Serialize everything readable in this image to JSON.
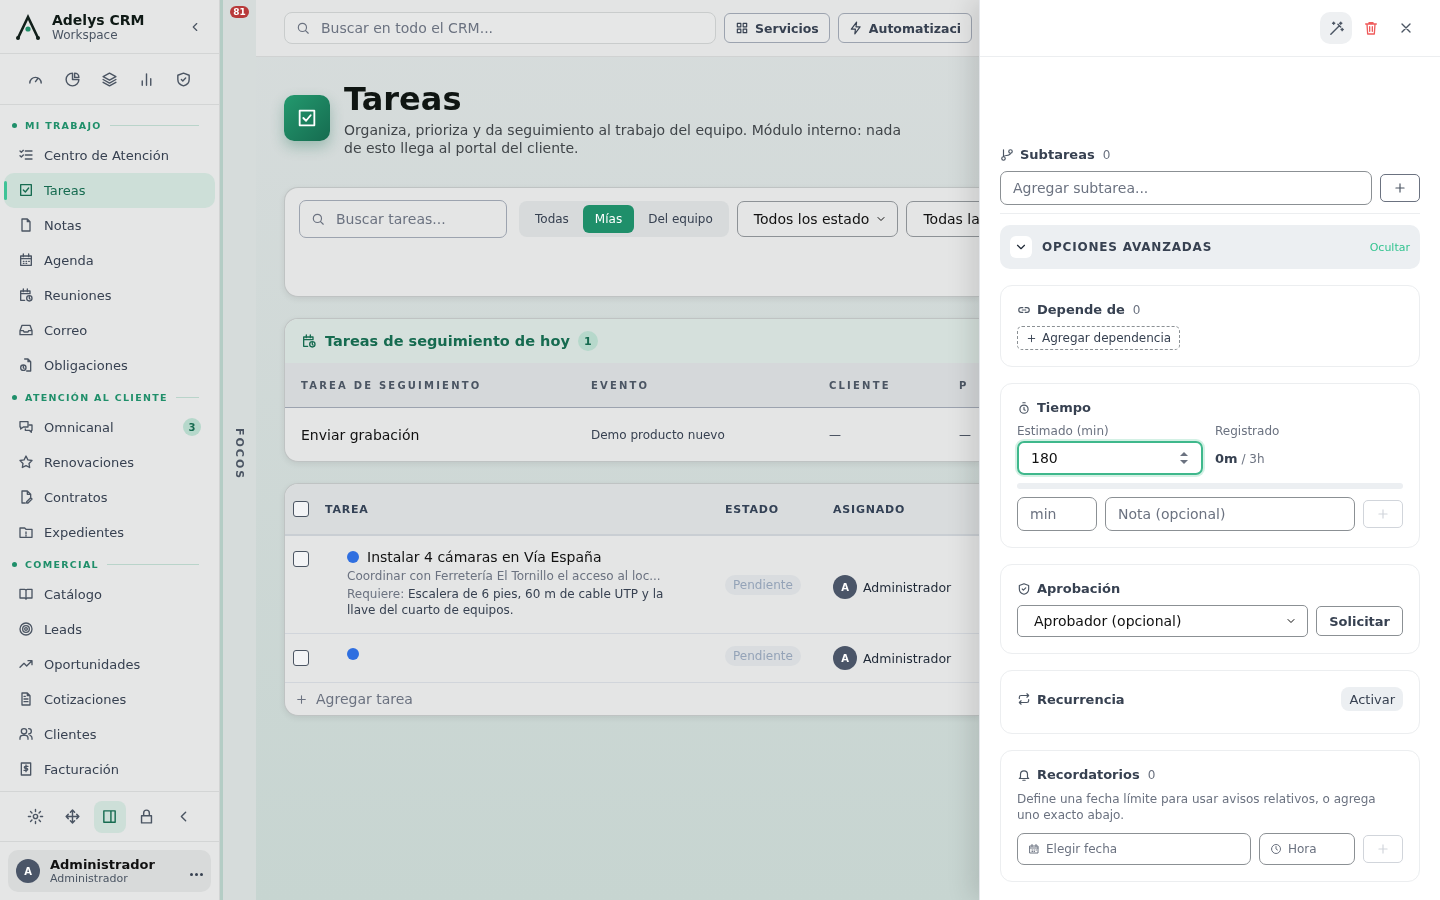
{
  "brand": {
    "name": "Adelys CRM",
    "subtitle": "Workspace"
  },
  "notification_badge": "81",
  "nav_sections": [
    {
      "title": "MI TRABAJO",
      "items": [
        {
          "label": "Centro de Atención",
          "selected": false
        },
        {
          "label": "Tareas",
          "selected": true
        },
        {
          "label": "Notas",
          "selected": false
        },
        {
          "label": "Agenda",
          "selected": false
        },
        {
          "label": "Reuniones",
          "selected": false
        },
        {
          "label": "Correo",
          "selected": false
        },
        {
          "label": "Obligaciones",
          "selected": false
        }
      ]
    },
    {
      "title": "ATENCIÓN AL CLIENTE",
      "items": [
        {
          "label": "Omnicanal",
          "selected": false,
          "badge": "3"
        },
        {
          "label": "Renovaciones",
          "selected": false
        },
        {
          "label": "Contratos",
          "selected": false
        },
        {
          "label": "Expedientes",
          "selected": false
        }
      ]
    },
    {
      "title": "COMERCIAL",
      "items": [
        {
          "label": "Catálogo",
          "selected": false
        },
        {
          "label": "Leads",
          "selected": false
        },
        {
          "label": "Oportunidades",
          "selected": false
        },
        {
          "label": "Cotizaciones",
          "selected": false
        },
        {
          "label": "Clientes",
          "selected": false
        },
        {
          "label": "Facturación",
          "selected": false
        }
      ]
    }
  ],
  "sidebar_tools": [
    {
      "selected": false
    },
    {
      "selected": false
    },
    {
      "selected": true
    },
    {
      "selected": false
    },
    {
      "selected": false
    }
  ],
  "user": {
    "avatar": "A",
    "name": "Administrador",
    "role": "Administrador"
  },
  "rail_label": "FOCOS",
  "search": {
    "placeholder": "Buscar en todo el CRM..."
  },
  "top_buttons": [
    "Servicios",
    "Automatizaci"
  ],
  "page": {
    "title": "Tareas",
    "description": "Organiza, prioriza y da seguimiento al trabajo del equipo. Módulo interno: nada de esto llega al portal del cliente."
  },
  "filters": {
    "search_placeholder": "Buscar tareas...",
    "scopes": [
      {
        "label": "Todas",
        "selected": false
      },
      {
        "label": "Mías",
        "selected": true
      },
      {
        "label": "Del equipo",
        "selected": false
      }
    ],
    "status_select": "Todos los estado",
    "other_select": "Todas la"
  },
  "followups": {
    "title": "Tareas de seguimiento de hoy",
    "count": "1",
    "columns": [
      "TAREA DE SEGUIMIENTO",
      "EVENTO",
      "CLIENTE",
      "P"
    ],
    "rows": [
      {
        "cells": [
          "Enviar grabación",
          "Demo producto nuevo",
          "—",
          "—"
        ]
      }
    ]
  },
  "tasks": {
    "columns": [
      "TAREA",
      "ESTADO",
      "ASIGNADO"
    ],
    "all_checked": false,
    "rows": [
      {
        "checked": false,
        "color": "#2f6fe0",
        "title": "Instalar 4 cámaras en Vía España",
        "summary": "Coordinar con Ferretería El Tornillo el acceso al loc...",
        "requirement_label": "Requiere:",
        "requirement": "Escalera de 6 pies, 60 m de cable UTP y la llave del cuarto de equipos.",
        "status": "Pendiente",
        "avatar": "A",
        "assignee": "Administrador"
      },
      {
        "checked": false,
        "color": "#2f6fe0",
        "status": "Pendiente",
        "avatar": "A",
        "assignee": "Administrador"
      }
    ],
    "add_label": "Agregar tarea"
  },
  "drawer": {
    "wand_selected": true,
    "subtasks": {
      "title": "Subtareas",
      "count": "0",
      "placeholder": "Agregar subtarea..."
    },
    "advanced": {
      "title": "OPCIONES AVANZADAS",
      "toggle": "Ocultar",
      "expanded": true
    },
    "depends": {
      "title": "Depende de",
      "count": "0",
      "button": "Agregar dependencia"
    },
    "time": {
      "title": "Tiempo",
      "estimate_label": "Estimado (min)",
      "estimate_value": "180",
      "logged_label": "Registrado",
      "logged": "0m",
      "logged_total": "/ 3h",
      "level": 0,
      "minutes_placeholder": "min",
      "note_placeholder": "Nota (opcional)"
    },
    "approval": {
      "title": "Aprobación",
      "select": "Aprobador (opcional)",
      "button": "Solicitar"
    },
    "recurrence": {
      "title": "Recurrencia",
      "button": "Activar"
    },
    "reminders": {
      "title": "Recordatorios",
      "count": "0",
      "hint": "Define una fecha límite para usar avisos relativos, o agrega uno exacto abajo.",
      "date_placeholder": "Elegir fecha",
      "time_placeholder": "Hora"
    }
  }
}
